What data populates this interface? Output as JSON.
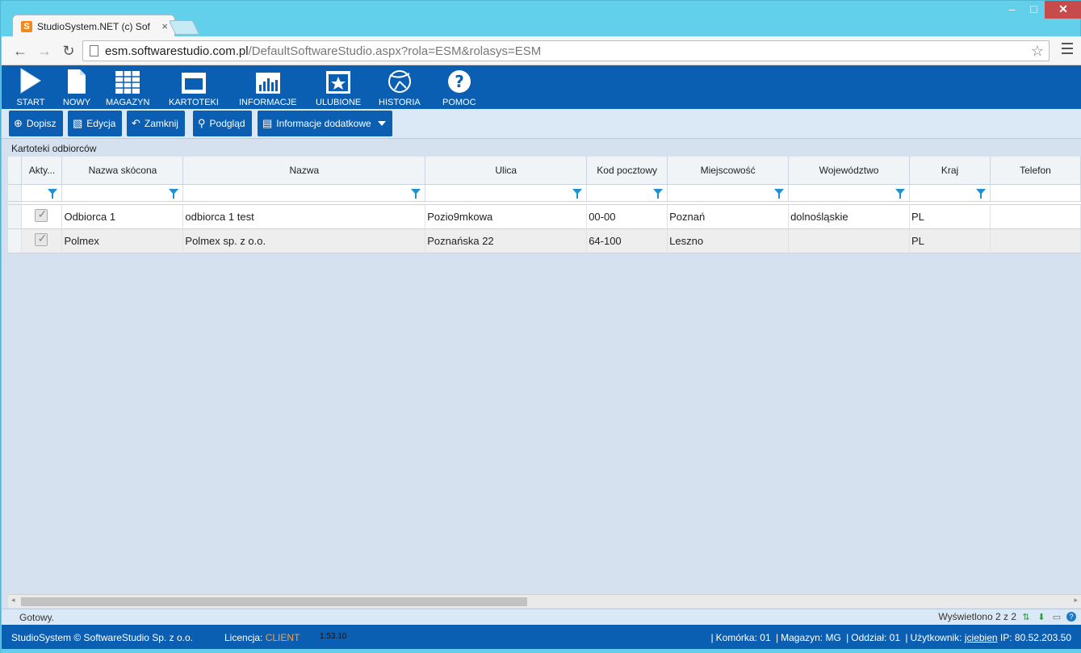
{
  "browser": {
    "tab_title": "StudioSystem.NET (c) Soft",
    "tab_favicon": "S",
    "url_host": "esm.softwarestudio.com.pl",
    "url_path": "/DefaultSoftwareStudio.aspx?rola=ESM&rolasys=ESM"
  },
  "topnav": [
    {
      "label": "START",
      "icon": "play-icon"
    },
    {
      "label": "NOWY",
      "icon": "new-document-icon"
    },
    {
      "label": "MAGAZYN",
      "icon": "warehouse-grid-icon"
    },
    {
      "label": "KARTOTEKI",
      "icon": "window-icon"
    },
    {
      "label": "INFORMACJE",
      "icon": "bar-chart-icon"
    },
    {
      "label": "ULUBIONE",
      "icon": "star-icon"
    },
    {
      "label": "HISTORIA",
      "icon": "history-icon"
    },
    {
      "label": "POMOC",
      "icon": "help-icon"
    }
  ],
  "actions": {
    "add": "Dopisz",
    "edit": "Edycja",
    "close": "Zamknij",
    "preview": "Podgląd",
    "more": "Informacje dodatkowe"
  },
  "section_title": "Kartoteki odbiorców",
  "grid": {
    "columns": [
      "Akty...",
      "Nazwa skócona",
      "Nazwa",
      "Ulica",
      "Kod pocztowy",
      "Miejscowość",
      "Województwo",
      "Kraj",
      "Telefon"
    ],
    "rows": [
      {
        "active": true,
        "short_name": "Odbiorca 1",
        "name": "odbiorca 1 test",
        "street": "Pozio9mkowa",
        "postal": "00-00",
        "city": "Poznań",
        "region": "dolnośląskie",
        "country": "PL",
        "phone": ""
      },
      {
        "active": true,
        "short_name": "Polmex",
        "name": "Polmex sp. z o.o.",
        "street": "Poznańska 22",
        "postal": "64-100",
        "city": "Leszno",
        "region": "",
        "country": "PL",
        "phone": ""
      }
    ]
  },
  "status": {
    "text": "Gotowy.",
    "shown": "Wyświetlono 2 z 2"
  },
  "footer": {
    "copyright": "StudioSystem © SoftwareStudio Sp. z o.o.",
    "license_label": "Licencja:",
    "license_value": "CLIENT",
    "time": "1:53.10",
    "cell_label": "Komórka:",
    "cell_value": "01",
    "warehouse_label": "Magazyn:",
    "warehouse_value": "MG",
    "branch_label": "Oddział:",
    "branch_value": "01",
    "user_label": "Użytkownik:",
    "user_value": "jciebien",
    "ip_label": "IP:",
    "ip_value": "80.52.203.50"
  },
  "colors": {
    "brand_blue": "#0a5fb2",
    "window_frame": "#62d0ea",
    "license_accent": "#f2a14d",
    "filter_icon": "#1e90d6"
  }
}
